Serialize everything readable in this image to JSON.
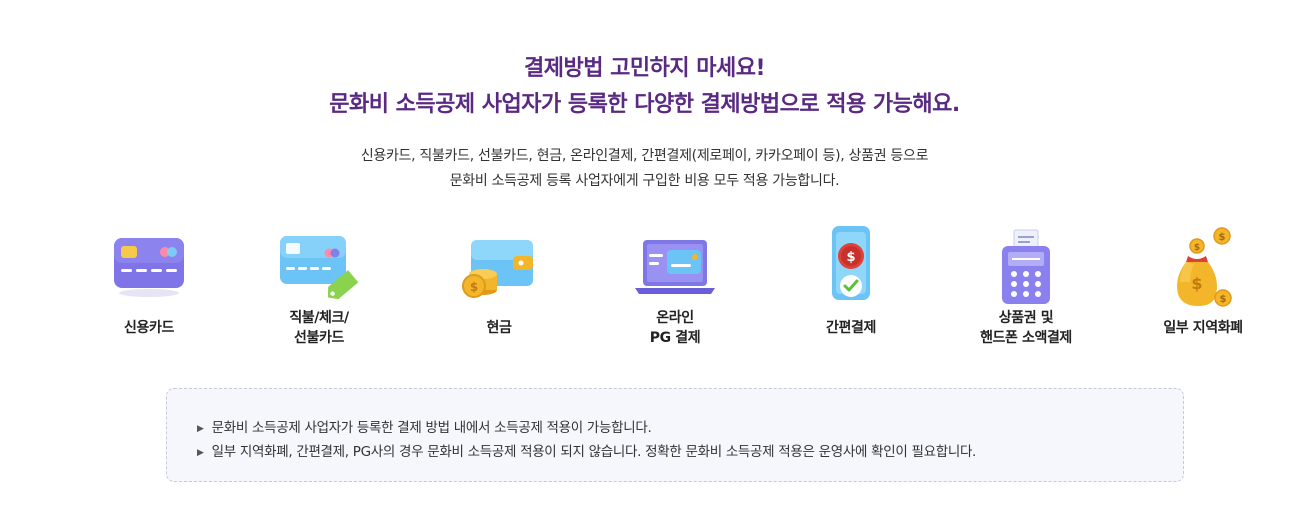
{
  "headline": {
    "line1": "결제방법 고민하지 마세요!",
    "line2": "문화비 소득공제 사업자가 등록한 다양한 결제방법으로 적용 가능해요."
  },
  "description": {
    "line1": "신용카드, 직불카드, 선불카드, 현금, 온라인결제, 간편결제(제로페이, 카카오페이 등), 상품권 등으로",
    "line2": "문화비 소득공제 등록 사업자에게 구입한 비용 모두 적용 가능합니다."
  },
  "methods": [
    {
      "icon": "credit-card-icon",
      "label_lines": [
        "신용카드"
      ]
    },
    {
      "icon": "debit-card-icon",
      "label_lines": [
        "직불/체크/",
        "선불카드"
      ]
    },
    {
      "icon": "cash-icon",
      "label_lines": [
        "현금"
      ]
    },
    {
      "icon": "online-payment-icon",
      "label_lines": [
        "온라인",
        "PG 결제"
      ]
    },
    {
      "icon": "mobile-payment-icon",
      "label_lines": [
        "간편결제"
      ]
    },
    {
      "icon": "voucher-terminal-icon",
      "label_lines": [
        "상품권 및",
        "핸드폰 소액결제"
      ]
    },
    {
      "icon": "local-currency-icon",
      "label_lines": [
        "일부 지역화폐"
      ]
    }
  ],
  "notice": {
    "bullet": "▶",
    "items": [
      "문화비 소득공제 사업자가 등록한 결제 방법 내에서 소득공제 적용이 가능합니다.",
      "일부 지역화폐, 간편결제, PG사의 경우 문화비 소득공제 적용이 되지 않습니다. 정확한 문화비 소득공제 적용은 운영사에 확인이 필요합니다."
    ]
  },
  "colors": {
    "headline": "#5a2a82",
    "notice_bg": "#f6f6fd",
    "card_purple": "#7f74e8",
    "sky_blue": "#6cc3f5",
    "gold": "#f3b62b"
  }
}
